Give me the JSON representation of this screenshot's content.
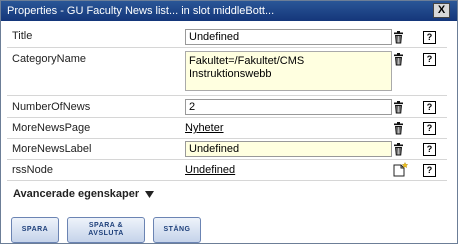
{
  "window": {
    "title": "Properties - GU Faculty News list... in slot middleBott...",
    "close_label": "X"
  },
  "properties": {
    "title": {
      "label": "Title",
      "value": "Undefined"
    },
    "category": {
      "label": "CategoryName",
      "value_line1": "Fakultet=/Fakultet/CMS",
      "value_line2": "Instruktionswebb"
    },
    "number_of_news": {
      "label": "NumberOfNews",
      "value": "2"
    },
    "more_news_page": {
      "label": "MoreNewsPage",
      "value": "Nyheter"
    },
    "more_news_label": {
      "label": "MoreNewsLabel",
      "value": "Undefined"
    },
    "rss_node": {
      "label": "rssNode",
      "value": "Undefined"
    }
  },
  "help_label": "?",
  "advanced": {
    "label": "Avancerade egenskaper"
  },
  "buttons": {
    "save": "SPARA",
    "save_close_line1": "SPARA &",
    "save_close_line2": "AVSLUTA",
    "close": "STÄNG"
  }
}
